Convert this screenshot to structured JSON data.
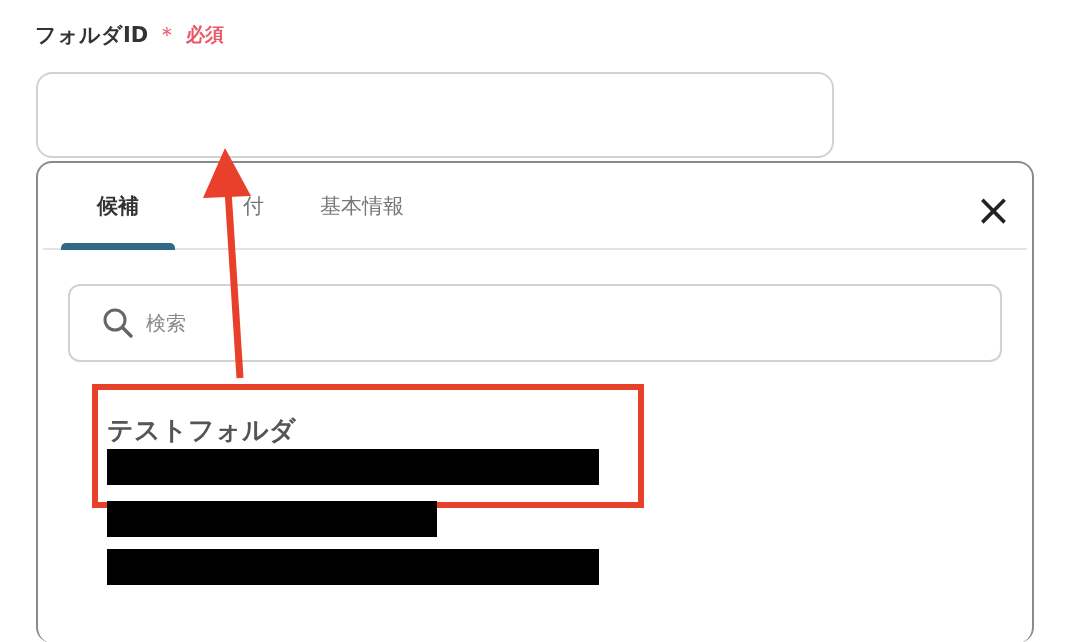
{
  "field": {
    "label": "フォルダID",
    "required_mark": "＊",
    "required_text": "必須"
  },
  "dropdown": {
    "tabs": [
      {
        "label": "候補",
        "selected": true
      },
      {
        "label": "付",
        "selected": false
      },
      {
        "label": "基本情報",
        "selected": false
      }
    ],
    "close": "×",
    "search": {
      "placeholder": "検索"
    },
    "items": [
      {
        "kind": "titled",
        "title": "テストフォルダ",
        "highlighted": true
      },
      {
        "kind": "redacted",
        "highlighted": false
      }
    ]
  },
  "annotations": [
    {
      "kind": "arrow"
    }
  ]
}
